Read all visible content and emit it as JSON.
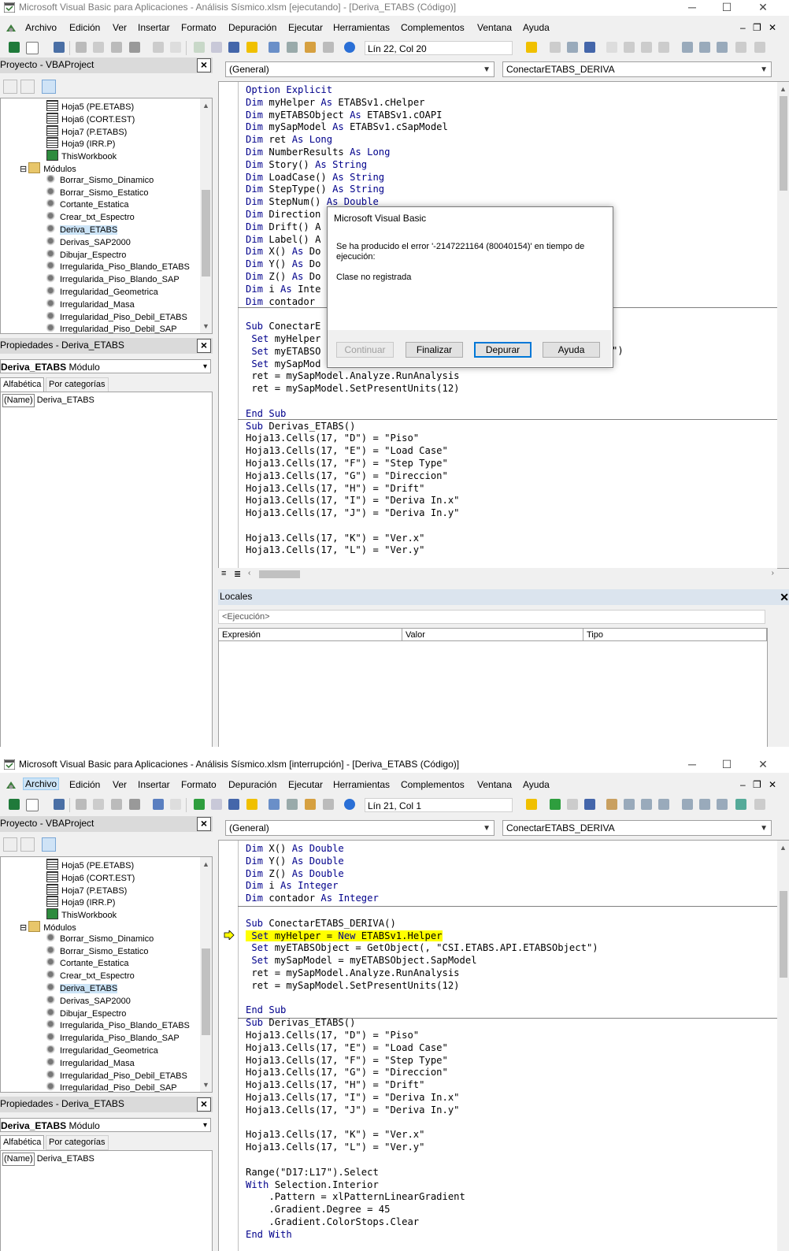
{
  "window": {
    "title_running": "Microsoft Visual Basic para Aplicaciones - Análisis Sísmico.xlsm [ejecutando] - [Deriva_ETABS (Código)]",
    "title_break": "Microsoft Visual Basic para Aplicaciones - Análisis Sísmico.xlsm [interrupción] - [Deriva_ETABS (Código)]",
    "minimize": "─",
    "maximize": "☐",
    "close": "✕"
  },
  "menu": [
    "Archivo",
    "Edición",
    "Ver",
    "Insertar",
    "Formato",
    "Depuración",
    "Ejecutar",
    "Herramientas",
    "Complementos",
    "Ventana",
    "Ayuda"
  ],
  "mdi_controls": {
    "min": "‒",
    "restore": "❐",
    "close": "✕"
  },
  "toolbar": {
    "linecol_running": "Lín 22, Col 20",
    "linecol_break": "Lín 21, Col 1"
  },
  "project": {
    "title": "Proyecto - VBAProject",
    "sheets": [
      "Hoja5 (PE.ETABS)",
      "Hoja6 (CORT.EST)",
      "Hoja7 (P.ETABS)",
      "Hoja9 (IRR.P)",
      "ThisWorkbook"
    ],
    "modules_label": "Módulos",
    "modules": [
      "Borrar_Sismo_Dinamico",
      "Borrar_Sismo_Estatico",
      "Cortante_Estatica",
      "Crear_txt_Espectro",
      "Deriva_ETABS",
      "Derivas_SAP2000",
      "Dibujar_Espectro",
      "Irregularida_Piso_Blando_ETABS",
      "Irregularida_Piso_Blando_SAP",
      "Irregularidad_Geometrica",
      "Irregularidad_Masa",
      "Irregularidad_Piso_Debil_ETABS",
      "Irregularidad_Piso_Debil_SAP"
    ]
  },
  "properties": {
    "title": "Propiedades - Deriva_ETABS",
    "object_name": "Deriva_ETABS",
    "object_type": "Módulo",
    "tab_alpha": "Alfabética",
    "tab_cat": "Por categorías",
    "prop_key": "(Name)",
    "prop_value": "Deriva_ETABS"
  },
  "code_header": {
    "object_combo": "(General)",
    "proc_combo": "ConectarETABS_DERIVA"
  },
  "code_top": [
    "Option Explicit",
    "Dim myHelper As ETABSv1.cHelper",
    "Dim myETABSObject As ETABSv1.cOAPI",
    "Dim mySapModel As ETABSv1.cSapModel",
    "Dim ret As Long",
    "Dim NumberResults As Long",
    "Dim Story() As String",
    "Dim LoadCase() As String",
    "Dim StepType() As String",
    "Dim StepNum() As Double",
    "Dim Direction",
    "Dim Drift() A",
    "Dim Label() A",
    "Dim X() As Do",
    "Dim Y() As Do",
    "Dim Z() As Do",
    "Dim i As Inte",
    "Dim contador ",
    "",
    "Sub ConectarE",
    " Set myHelper",
    " Set myETABSO",
    " Set mySapMod",
    " ret = mySapModel.Analyze.RunAnalysis",
    " ret = mySapModel.SetPresentUnits(12)",
    "",
    "End Sub",
    "Sub Derivas_ETABS()",
    "Hoja13.Cells(17, \"D\") = \"Piso\"",
    "Hoja13.Cells(17, \"E\") = \"Load Case\"",
    "Hoja13.Cells(17, \"F\") = \"Step Type\"",
    "Hoja13.Cells(17, \"G\") = \"Direccion\"",
    "Hoja13.Cells(17, \"H\") = \"Drift\"",
    "Hoja13.Cells(17, \"I\") = \"Deriva In.x\"",
    "Hoja13.Cells(17, \"J\") = \"Deriva In.y\"",
    "",
    "Hoja13.Cells(17, \"K\") = \"Ver.x\"",
    "Hoja13.Cells(17, \"L\") = \"Ver.y\""
  ],
  "code_bottom": [
    "Dim X() As Double",
    "Dim Y() As Double",
    "Dim Z() As Double",
    "Dim i As Integer",
    "Dim contador As Integer",
    "",
    "Sub ConectarETABS_DERIVA()",
    " Set myHelper = New ETABSv1.Helper",
    " Set myETABSObject = GetObject(, \"CSI.ETABS.API.ETABSObject\")",
    " Set mySapModel = myETABSObject.SapModel",
    " ret = mySapModel.Analyze.RunAnalysis",
    " ret = mySapModel.SetPresentUnits(12)",
    "",
    "End Sub",
    "Sub Derivas_ETABS()",
    "Hoja13.Cells(17, \"D\") = \"Piso\"",
    "Hoja13.Cells(17, \"E\") = \"Load Case\"",
    "Hoja13.Cells(17, \"F\") = \"Step Type\"",
    "Hoja13.Cells(17, \"G\") = \"Direccion\"",
    "Hoja13.Cells(17, \"H\") = \"Drift\"",
    "Hoja13.Cells(17, \"I\") = \"Deriva In.x\"",
    "Hoja13.Cells(17, \"J\") = \"Deriva In.y\"",
    "",
    "Hoja13.Cells(17, \"K\") = \"Ver.x\"",
    "Hoja13.Cells(17, \"L\") = \"Ver.y\"",
    "",
    "Range(\"D17:L17\").Select",
    "With Selection.Interior",
    "    .Pattern = xlPatternLinearGradient",
    "    .Gradient.Degree = 45",
    "    .Gradient.ColorStops.Clear",
    "End With"
  ],
  "dialog_tail": "\")",
  "locals": {
    "title": "Locales",
    "context": "<Ejecución>",
    "columns": [
      "Expresión",
      "Valor",
      "Tipo"
    ]
  },
  "dialog": {
    "title": "Microsoft Visual Basic",
    "message": "Se ha producido el error '-2147221164 (80040154)' en tiempo de ejecución:",
    "detail": "Clase no registrada",
    "buttons": [
      "Continuar",
      "Finalizar",
      "Depurar",
      "Ayuda"
    ]
  },
  "colors": {
    "keyword": "#00008b",
    "highlight": "#ffff00",
    "accent": "#0078d7"
  }
}
